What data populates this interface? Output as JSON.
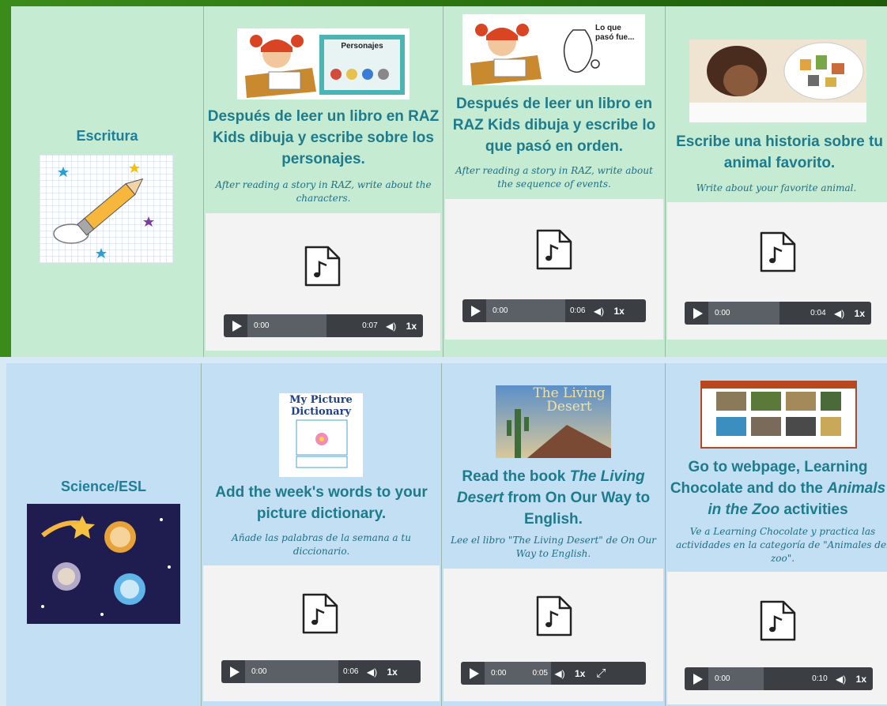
{
  "rows": [
    {
      "label": "Escritura",
      "cards": [
        {
          "title": "Después de leer un libro en RAZ Kids dibuja y escribe sobre los personajes.",
          "subtitle": "After reading a story in RAZ, write about the characters.",
          "image_text": "Personajes",
          "audio": {
            "current": "0:00",
            "duration": "0:07",
            "rate": "1x"
          }
        },
        {
          "title": "Después de leer un libro en RAZ Kids dibuja y escribe lo que pasó en orden.",
          "subtitle": "After reading a story in RAZ, write about the sequence of events.",
          "image_text": "Lo que pasó fue...",
          "audio": {
            "current": "0:00",
            "duration": "0:06",
            "rate": "1x"
          }
        },
        {
          "title": "Escribe una historia sobre tu animal favorito.",
          "subtitle": "Write about your favorite animal.",
          "audio": {
            "current": "0:00",
            "duration": "0:04",
            "rate": "1x"
          }
        }
      ]
    },
    {
      "label": "Science/ESL",
      "cards": [
        {
          "title": "Add the week's words to your picture dictionary.",
          "subtitle": "Añade las palabras de la semana a tu diccionario.",
          "image_text": "My Picture Dictionary",
          "audio": {
            "current": "0:00",
            "duration": "0:06",
            "rate": "1x"
          }
        },
        {
          "title_pre": "Read the book ",
          "title_em": "The Living Desert",
          "title_post": " from On Our Way to English.",
          "subtitle": "Lee el libro \"The Living Desert\" de On Our Way to English.",
          "image_text": "The Living Desert",
          "audio": {
            "current": "0:00",
            "duration": "0:05",
            "rate": "1x"
          }
        },
        {
          "title_pre": "Go to webpage,  Learning Chocolate and do the ",
          "title_em": "Animals in the Zoo",
          "title_post": " activities",
          "subtitle": "Ve a Learning Chocolate y practica las actividades en la categoría de \"Animales del zoo\".",
          "audio": {
            "current": "0:00",
            "duration": "0:10",
            "rate": "1x"
          }
        }
      ]
    }
  ],
  "icons": {
    "audio_file": "music-file-icon",
    "play": "play-icon",
    "volume": "volume-icon",
    "expand": "expand-icon"
  },
  "colors": {
    "green_cell": "#c6ebd3",
    "blue_cell": "#c3dff3",
    "title": "#1d7b8c",
    "player": "#3b3f44"
  }
}
